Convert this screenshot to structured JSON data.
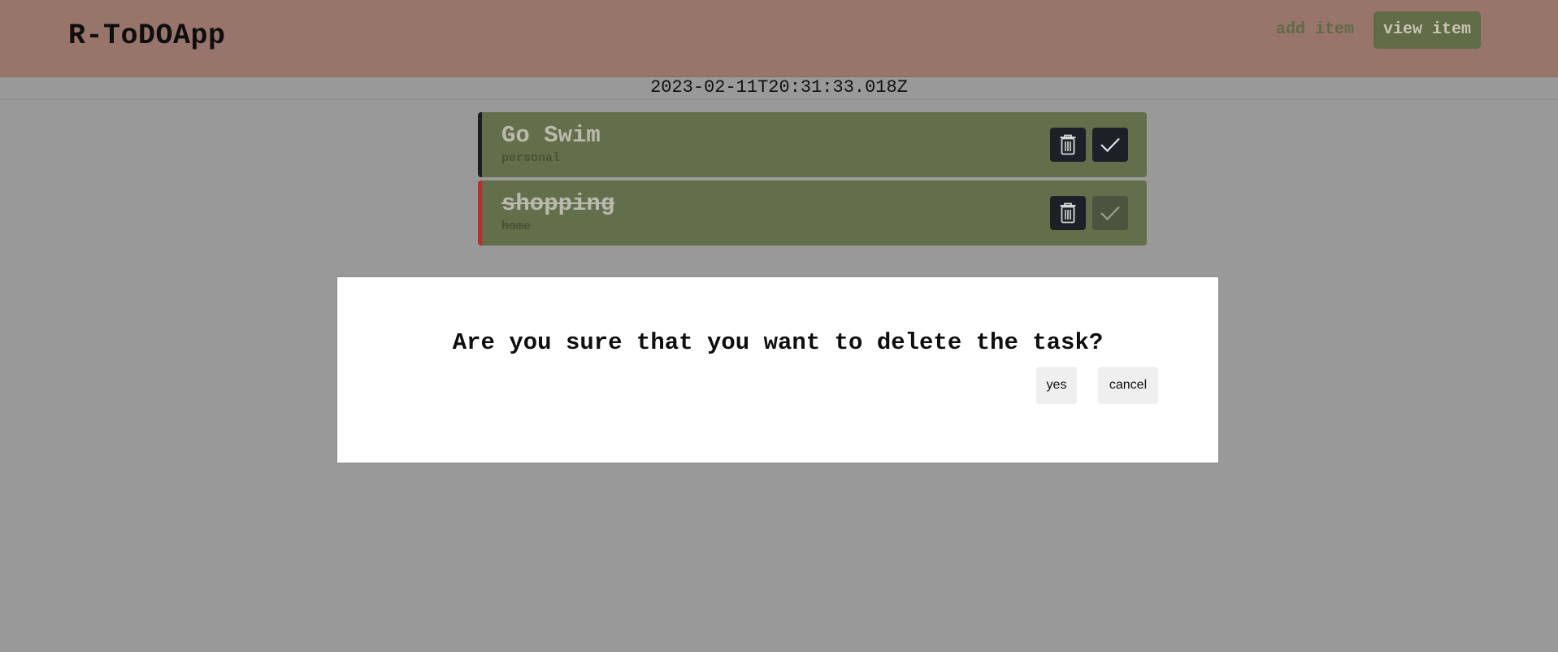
{
  "header": {
    "brand": "R-ToDOApp",
    "nav": {
      "add_item": "add item",
      "view_item": "view item"
    }
  },
  "datetime": "2023-02-11T20:31:33.018Z",
  "tasks": [
    {
      "title": "Go Swim",
      "category": "personal",
      "done": false,
      "accent": "#1a1e22"
    },
    {
      "title": "shopping",
      "category": "home",
      "done": true,
      "accent": "#b5302e"
    }
  ],
  "modal": {
    "message": "Are you sure that you want to delete the task?",
    "yes_label": "yes",
    "cancel_label": "cancel"
  },
  "icons": {
    "delete": "trash-icon",
    "complete": "check-icon"
  }
}
